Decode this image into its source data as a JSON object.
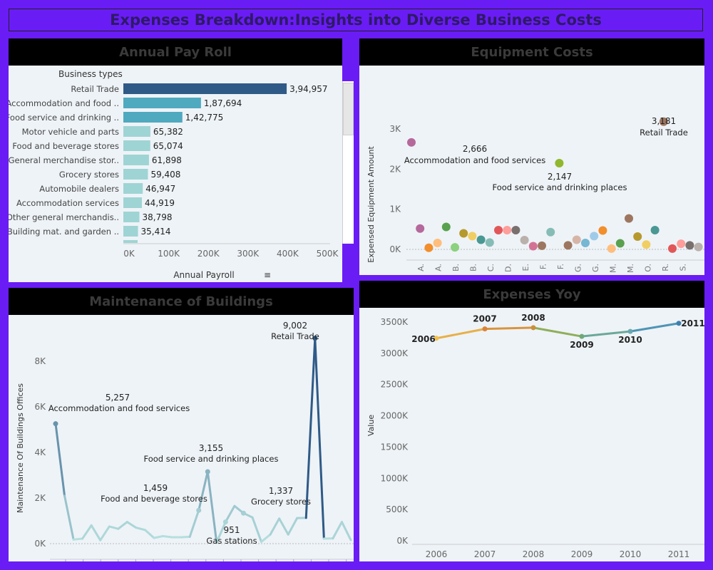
{
  "dashboard": {
    "title": "Expenses Breakdown:Insights into Diverse Business Costs"
  },
  "panels": {
    "payroll": "Annual Pay Roll",
    "equipment": "Equipment Costs",
    "maintenance": "Maintenance of Buildings",
    "yoy": "Expenses Yoy"
  },
  "colors": {
    "background": "#6a1cf5",
    "panel": "#eef3f7",
    "header": "#000000",
    "bar_dark": "#2f5a87",
    "bar_mid": "#4fa9bf",
    "bar_light": "#9fd4d4",
    "line_teal": "#7ec4cf"
  },
  "chart_data": [
    {
      "type": "bar",
      "orientation": "horizontal",
      "title": "Annual Pay Roll",
      "ylabel": "Business types",
      "xlabel": "Annual Payroll",
      "categories": [
        "Retail Trade",
        "Accommodation and food ..",
        "Food service and drinking ..",
        "Motor vehicle and parts",
        "Food and beverage stores",
        "General merchandise stor..",
        "Grocery stores",
        "Automobile dealers",
        "Accommodation services",
        "Other general merchandis..",
        "Building mat. and garden .."
      ],
      "values": [
        394957,
        187694,
        142775,
        65382,
        65074,
        61898,
        59408,
        46947,
        44919,
        38798,
        35414
      ],
      "value_labels": [
        "3,94,957",
        "1,87,694",
        "1,42,775",
        "65,382",
        "65,074",
        "61,898",
        "59,408",
        "46,947",
        "44,919",
        "38,798",
        "35,414"
      ],
      "xlim": [
        0,
        500000
      ],
      "xticks": [
        "0K",
        "100K",
        "200K",
        "300K",
        "400K",
        "500K"
      ]
    },
    {
      "type": "scatter",
      "title": "Equipment Costs",
      "ylabel": "Expensed Equipment Amount",
      "ylim": [
        0,
        3200
      ],
      "yticks": [
        "0K",
        "1K",
        "2K",
        "3K"
      ],
      "x_tick_labels": [
        "A.",
        "A.",
        "B.",
        "B.",
        "C.",
        "D.",
        "E.",
        "F.",
        "F.",
        "G.",
        "G.",
        "M.",
        "M.",
        "O.",
        "R.",
        "S."
      ],
      "points": [
        {
          "x": 1,
          "y": 2666,
          "color": "#b5689b"
        },
        {
          "x": 2,
          "y": 520,
          "color": "#b5689b"
        },
        {
          "x": 3,
          "y": 40,
          "color": "#f28e2b"
        },
        {
          "x": 4,
          "y": 160,
          "color": "#ffbe7d"
        },
        {
          "x": 5,
          "y": 560,
          "color": "#59a14f"
        },
        {
          "x": 6,
          "y": 50,
          "color": "#8cd17d"
        },
        {
          "x": 7,
          "y": 400,
          "color": "#b6992d"
        },
        {
          "x": 8,
          "y": 330,
          "color": "#f1ce63"
        },
        {
          "x": 9,
          "y": 240,
          "color": "#499894"
        },
        {
          "x": 10,
          "y": 170,
          "color": "#86bcb6"
        },
        {
          "x": 11,
          "y": 480,
          "color": "#e15759"
        },
        {
          "x": 12,
          "y": 480,
          "color": "#ff9d9a"
        },
        {
          "x": 13,
          "y": 480,
          "color": "#79706e"
        },
        {
          "x": 14,
          "y": 230,
          "color": "#bab0ac"
        },
        {
          "x": 15,
          "y": 80,
          "color": "#d37295"
        },
        {
          "x": 16,
          "y": 90,
          "color": "#9d7660"
        },
        {
          "x": 17,
          "y": 430,
          "color": "#86bcb6"
        },
        {
          "x": 18,
          "y": 2147,
          "color": "#8fb82c"
        },
        {
          "x": 19,
          "y": 100,
          "color": "#9d7660"
        },
        {
          "x": 20,
          "y": 240,
          "color": "#d7b5a6"
        },
        {
          "x": 21,
          "y": 160,
          "color": "#76b7d2"
        },
        {
          "x": 22,
          "y": 330,
          "color": "#a0cbe8"
        },
        {
          "x": 23,
          "y": 470,
          "color": "#f28e2b"
        },
        {
          "x": 24,
          "y": 20,
          "color": "#ffbe7d"
        },
        {
          "x": 25,
          "y": 150,
          "color": "#59a14f"
        },
        {
          "x": 26,
          "y": 770,
          "color": "#9d7660"
        },
        {
          "x": 27,
          "y": 320,
          "color": "#b6992d"
        },
        {
          "x": 28,
          "y": 120,
          "color": "#f1ce63"
        },
        {
          "x": 29,
          "y": 480,
          "color": "#499894"
        },
        {
          "x": 30,
          "y": 3181,
          "color": "#9d7660"
        },
        {
          "x": 31,
          "y": 20,
          "color": "#e15759"
        },
        {
          "x": 32,
          "y": 140,
          "color": "#ff9d9a"
        },
        {
          "x": 33,
          "y": 100,
          "color": "#79706e"
        },
        {
          "x": 34,
          "y": 60,
          "color": "#bab0ac"
        }
      ],
      "annotations": [
        {
          "value": "2,666",
          "label": "Accommodation and food services"
        },
        {
          "value": "2,147",
          "label": "Food service and drinking places"
        },
        {
          "value": "3,181",
          "label": "Retail Trade"
        }
      ]
    },
    {
      "type": "line",
      "title": "Maintenance of Buildings",
      "ylabel": "Maintenance Of Buildings Offices",
      "ylim": [
        0,
        9400
      ],
      "yticks": [
        "0K",
        "2K",
        "4K",
        "6K",
        "8K"
      ],
      "values": [
        5257,
        2100,
        180,
        220,
        800,
        150,
        750,
        650,
        950,
        700,
        600,
        250,
        330,
        280,
        280,
        300,
        1459,
        3155,
        50,
        951,
        1650,
        1337,
        1150,
        80,
        400,
        1100,
        400,
        1120,
        1130,
        9002,
        220,
        230,
        950,
        160
      ],
      "annotations": [
        {
          "index": 0,
          "value": "5,257",
          "label": "Accommodation and food services"
        },
        {
          "index": 16,
          "value": "1,459",
          "label": "Food and beverage stores"
        },
        {
          "index": 17,
          "value": "3,155",
          "label": "Food service and drinking places"
        },
        {
          "index": 19,
          "value": "951",
          "label": "Gas stations"
        },
        {
          "index": 21,
          "value": "1,337",
          "label": "Grocery stores"
        },
        {
          "index": 29,
          "value": "9,002",
          "label": "Retail Trade"
        }
      ]
    },
    {
      "type": "line",
      "title": "Expenses Yoy",
      "ylabel": "Value",
      "x": [
        "2006",
        "2007",
        "2008",
        "2009",
        "2010",
        "2011"
      ],
      "values": [
        3240000,
        3390000,
        3410000,
        3270000,
        3350000,
        3480000
      ],
      "ylim": [
        0,
        3600000
      ],
      "yticks": [
        "0K",
        "500K",
        "1000K",
        "1500K",
        "2000K",
        "2500K",
        "3000K",
        "3500K"
      ]
    }
  ]
}
